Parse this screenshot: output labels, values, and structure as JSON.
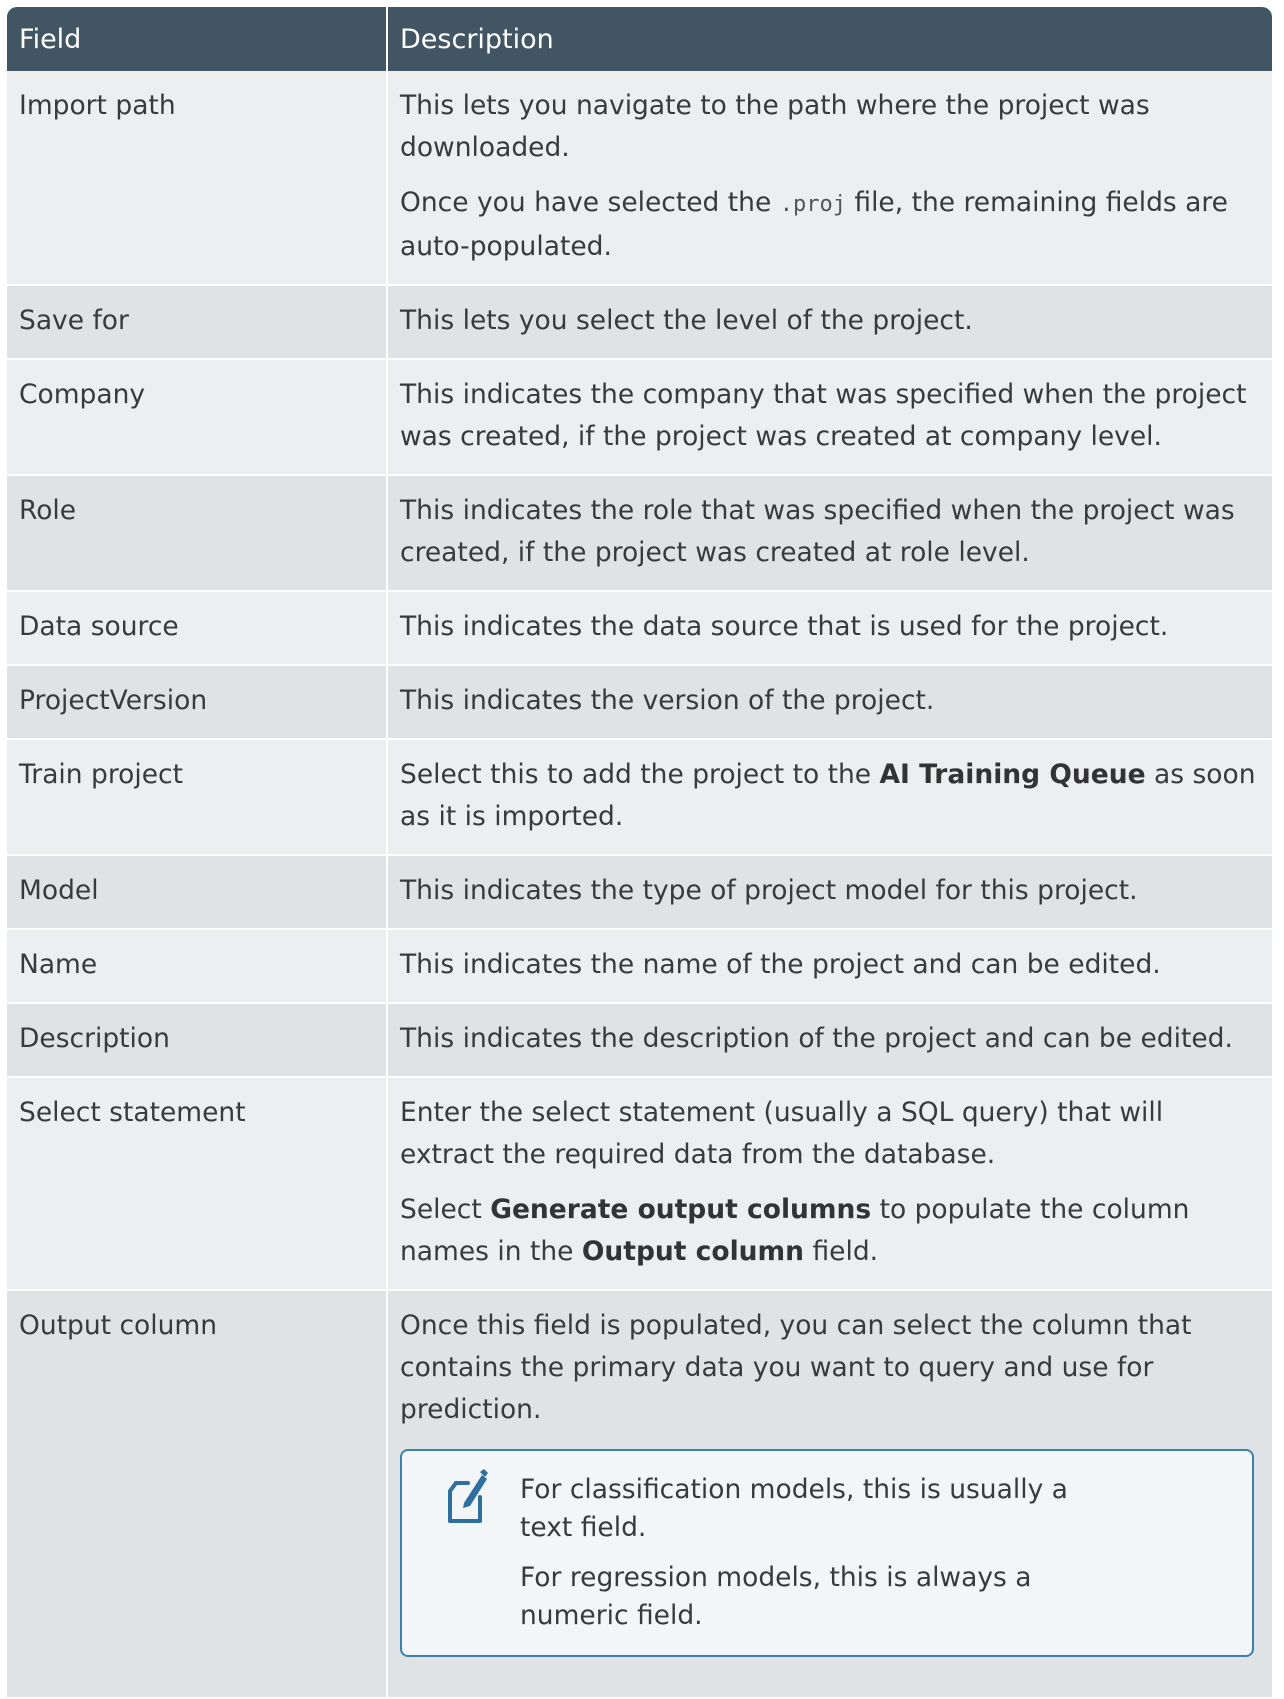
{
  "table": {
    "headers": {
      "field": "Field",
      "description": "Description"
    },
    "rows": {
      "import_path": {
        "field": "Import path",
        "p1": "This lets you navigate to the path where the project was downloaded.",
        "p2_before": "Once you have selected the ",
        "p2_code": ".proj",
        "p2_after": " file, the remaining fields are auto-populated."
      },
      "save_for": {
        "field": "Save for",
        "desc": "This lets you select the level of the project."
      },
      "company": {
        "field": "Company",
        "desc": "This indicates the company that was specified when the project was created, if the project was created at company level."
      },
      "role": {
        "field": "Role",
        "desc": "This indicates the role that was specified when the project was created, if the project was created at role level."
      },
      "data_source": {
        "field": "Data source",
        "desc": "This indicates the data source that is used for the project."
      },
      "project_version": {
        "field": "ProjectVersion",
        "desc": "This indicates the version of the project."
      },
      "train_project": {
        "field": "Train project",
        "before": "Select this to add the project to the ",
        "bold": "AI Training Queue",
        "after": " as soon as it is imported."
      },
      "model": {
        "field": "Model",
        "desc": "This indicates the type of project model for this project."
      },
      "name": {
        "field": "Name",
        "desc": "This indicates the name of the project and can be edited."
      },
      "description": {
        "field": "Description",
        "desc": "This indicates the description of the project and can be edited."
      },
      "select_statement": {
        "field": "Select statement",
        "p1": "Enter the select statement (usually a SQL query) that will extract the required data from the database.",
        "p2_before": "Select ",
        "p2_bold1": "Generate output columns",
        "p2_mid": " to populate the column names in the ",
        "p2_bold2": "Output column",
        "p2_after": " field."
      },
      "output_column": {
        "field": "Output column",
        "p1": "Once this field is populated, you can select the column that contains the primary data you want to query and use for prediction.",
        "note_icon": "note-pencil-icon",
        "note1": "For classification models, this is usually a text field.",
        "note2": "For regression models, this is always a numeric field."
      }
    }
  },
  "colors": {
    "header_bg": "#425563",
    "row_light": "#eceef0",
    "row_dark": "#e0e3e6",
    "note_border": "#3d7fae"
  }
}
